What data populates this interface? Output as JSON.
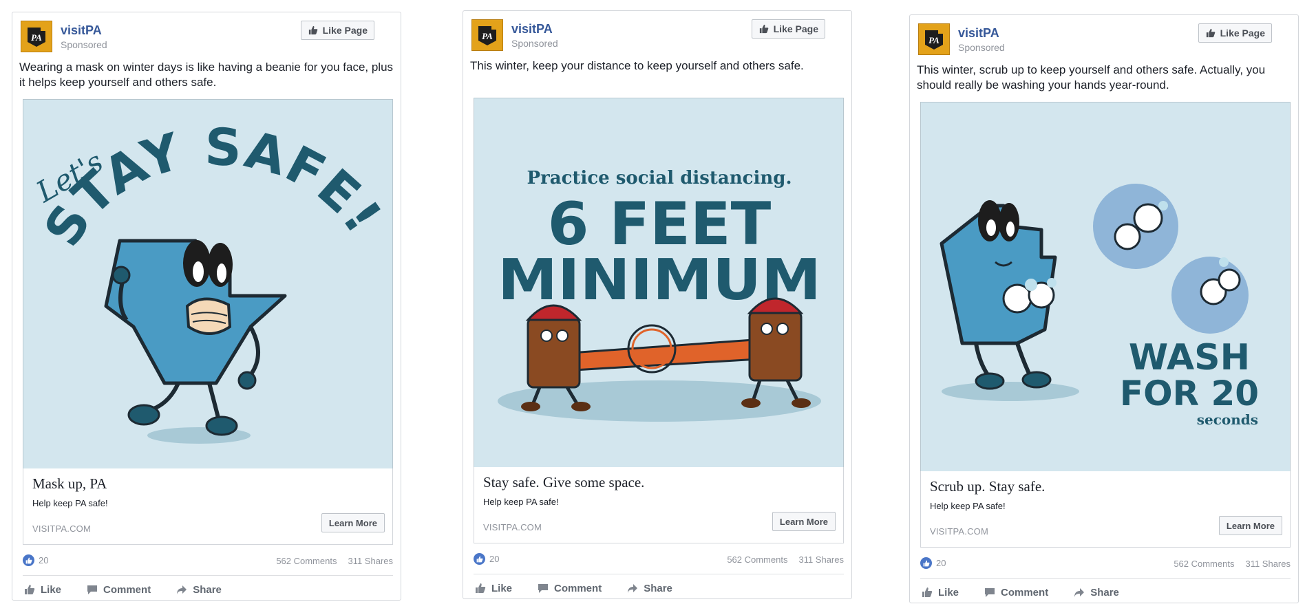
{
  "colors": {
    "page_name": "#365899",
    "art_bg": "#d3e6ee",
    "art_dark": "#1f5a6e",
    "art_blue": "#4a9bc4",
    "like_blue": "#4a76c8"
  },
  "icons": {
    "like_page": "thumbs-up-icon",
    "reaction": "like-reaction-icon",
    "like": "thumbs-up-icon",
    "comment": "comment-icon",
    "share": "share-arrow-icon",
    "avatar": "visitpa-logo"
  },
  "ads": [
    {
      "page_name": "visitPA",
      "sponsored": "Sponsored",
      "like_page_label": "Like Page",
      "caption": "Wearing a mask on winter days is like having a beanie for you face, plus it helps keep yourself and others safe.",
      "art": {
        "script_text": "Let's",
        "lines": [
          "STAY SAFE!"
        ]
      },
      "headline": "Mask up, PA",
      "description": "Help keep PA safe!",
      "domain": "VISITPA.COM",
      "cta": "Learn More",
      "likes": "20",
      "comments": "562 Comments",
      "shares": "311 Shares",
      "actions": {
        "like": "Like",
        "comment": "Comment",
        "share": "Share"
      }
    },
    {
      "page_name": "visitPA",
      "sponsored": "Sponsored",
      "like_page_label": "Like Page",
      "caption": "This winter, keep your distance to keep yourself and others safe.",
      "art": {
        "script_text": "Practice social distancing.",
        "lines": [
          "6 FEET",
          "MINIMUM"
        ]
      },
      "headline": "Stay safe. Give some space.",
      "description": "Help keep PA safe!",
      "domain": "VISITPA.COM",
      "cta": "Learn More",
      "likes": "20",
      "comments": "562 Comments",
      "shares": "311 Shares",
      "actions": {
        "like": "Like",
        "comment": "Comment",
        "share": "Share"
      }
    },
    {
      "page_name": "visitPA",
      "sponsored": "Sponsored",
      "like_page_label": "Like Page",
      "caption": "This winter, scrub up to keep yourself and others safe. Actually, you should really be washing your hands year-round.",
      "art": {
        "script_text": "seconds",
        "lines": [
          "WASH",
          "FOR 20"
        ]
      },
      "headline": "Scrub up. Stay safe.",
      "description": "Help keep PA safe!",
      "domain": "VISITPA.COM",
      "cta": "Learn More",
      "likes": "20",
      "comments": "562 Comments",
      "shares": "311 Shares",
      "actions": {
        "like": "Like",
        "comment": "Comment",
        "share": "Share"
      }
    }
  ]
}
